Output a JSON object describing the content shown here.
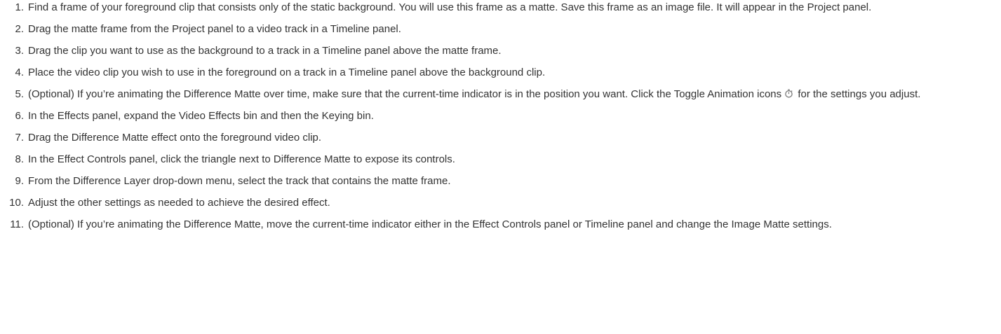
{
  "steps": [
    {
      "num": "1",
      "text": "Find a frame of your foreground clip that consists only of the static background. You will use this frame as a matte. Save this frame as an image file. It will appear in the Project panel."
    },
    {
      "num": "2",
      "text": "Drag the matte frame from the Project panel to a video track in a Timeline panel."
    },
    {
      "num": "3",
      "text": "Drag the clip you want to use as the background to a track in a Timeline panel above the matte frame."
    },
    {
      "num": "4",
      "text": "Place the video clip you wish to use in the foreground on a track in a Timeline panel above the background clip."
    },
    {
      "num": "5",
      "text_before_icon": "(Optional) If you’re animating the Difference Matte over time, make sure that the current-time indicator is in the position you want. Click the Toggle Animation icons",
      "icon": "stopwatch-icon",
      "text_after_icon": "for the settings you adjust."
    },
    {
      "num": "6",
      "text": "In the Effects panel, expand the Video Effects bin and then the Keying bin."
    },
    {
      "num": "7",
      "text": "Drag the Difference Matte effect onto the foreground video clip."
    },
    {
      "num": "8",
      "text": "In the Effect Controls panel, click the triangle next to Difference Matte to expose its controls."
    },
    {
      "num": "9",
      "text": "From the Difference Layer drop-down menu, select the track that contains the matte frame."
    },
    {
      "num": "10",
      "text": "Adjust the other settings as needed to achieve the desired effect."
    },
    {
      "num": "11",
      "text": "(Optional) If you’re animating the Difference Matte, move the current-time indicator either in the Effect Controls panel or Timeline panel and change the Image Matte settings."
    }
  ],
  "colors": {
    "text": "#333333",
    "background": "#ffffff",
    "icon": "#777777"
  }
}
